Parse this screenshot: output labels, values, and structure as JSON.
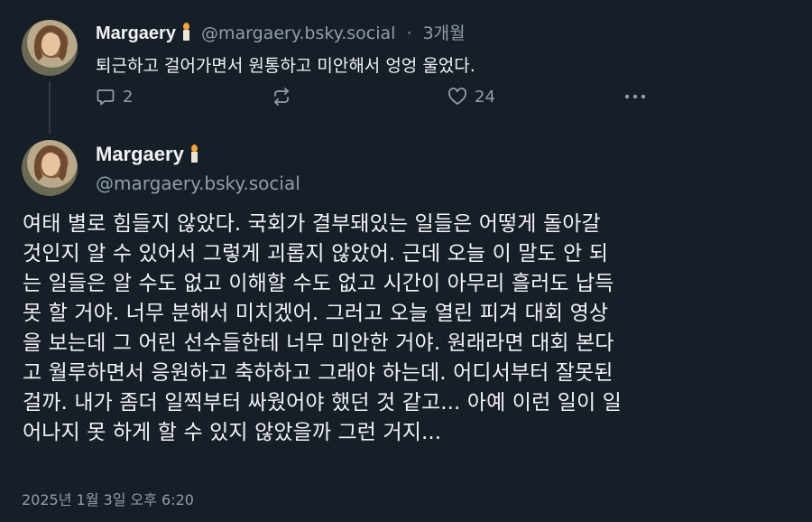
{
  "parent_post": {
    "author_name": "Margaery",
    "author_handle": "@margaery.bsky.social",
    "separator": "·",
    "relative_time": "3개월",
    "text": "퇴근하고 걸어가면서 원통하고 미안해서 엉엉 울었다.",
    "actions": {
      "reply_count": "2",
      "repost_count": "",
      "like_count": "24"
    }
  },
  "main_post": {
    "author_name": "Margaery",
    "author_handle": "@margaery.bsky.social",
    "text_lines": [
      "여태 별로 힘들지 않았다. 국회가 결부돼있는 일들은 어떻게 돌아갈",
      "것인지 알 수 있어서 그렇게 괴롭지 않았어. 근데 오늘 이 말도 안 되",
      "는 일들은 알 수도 없고 이해할 수도 없고 시간이 아무리 흘러도 납득",
      "못 할 거야. 너무 분해서 미치겠어. 그러고 오늘 열린 피겨 대회 영상",
      "을 보는데 그 어린 선수들한테 너무 미안한 거야. 원래라면 대회 본다",
      "고 월루하면서 응원하고 축하하고 그래야 하는데. 어디서부터 잘못된",
      "걸까. 내가 좀더 일찍부터 싸웠어야 했던 것 같고... 아예 이런 일이 일",
      "어나지 못 하게 할 수 있지 않았을까 그런 거지..."
    ],
    "timestamp": "2025년 1월 3일 오후 6:20"
  },
  "icons": {
    "reply": "speech-bubble-icon",
    "repost": "repost-arrows-icon",
    "like": "heart-icon",
    "more": "more-dots-icon",
    "badge": "candle-icon"
  },
  "colors": {
    "background": "#161e27",
    "text": "#f1f3f5",
    "muted": "#8f9eae",
    "thread_line": "#2e3b49"
  }
}
